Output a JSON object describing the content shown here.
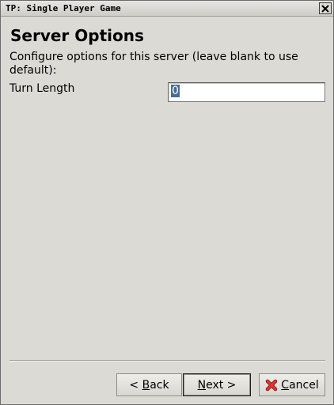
{
  "window": {
    "title": "TP: Single Player Game",
    "close_icon": "close-icon"
  },
  "page": {
    "heading": "Server Options",
    "description": "Configure options for this server (leave blank to use default):"
  },
  "fields": [
    {
      "label": "Turn Length",
      "value": "0"
    }
  ],
  "buttons": {
    "back": {
      "prefix": "< ",
      "mnemonic": "B",
      "rest": "ack"
    },
    "next": {
      "mnemonic": "N",
      "rest": "ext >"
    },
    "cancel": {
      "mnemonic": "C",
      "rest": "ancel",
      "icon": "cancel-x-icon"
    }
  },
  "colors": {
    "background": "#dcdad5",
    "selection": "#4a6a90",
    "cancel_icon": "#d9302a"
  }
}
